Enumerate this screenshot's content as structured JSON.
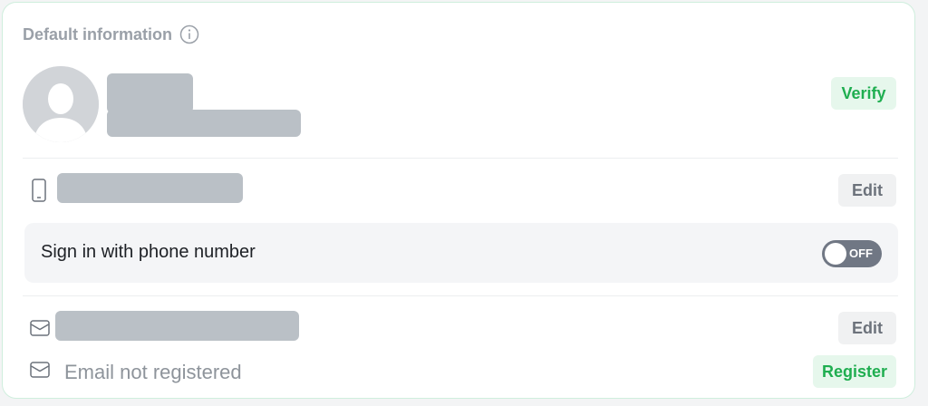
{
  "section": {
    "title": "Default information",
    "info_icon": "info-circle-icon"
  },
  "profile": {
    "avatar_icon": "user-silhouette-icon",
    "verify_label": "Verify"
  },
  "phone": {
    "icon": "phone-icon",
    "edit_label": "Edit"
  },
  "signin_phone": {
    "label": "Sign in with phone number",
    "toggle_state": "OFF"
  },
  "email": {
    "icon": "mail-icon",
    "edit_label": "Edit"
  },
  "email_secondary": {
    "icon": "mail-icon",
    "status_text": "Email not registered",
    "register_label": "Register"
  },
  "colors": {
    "accent_green": "#1fae50",
    "accent_green_bg": "#e6f7ec",
    "toggle_off": "#707784",
    "redaction": "#bac0c6"
  }
}
